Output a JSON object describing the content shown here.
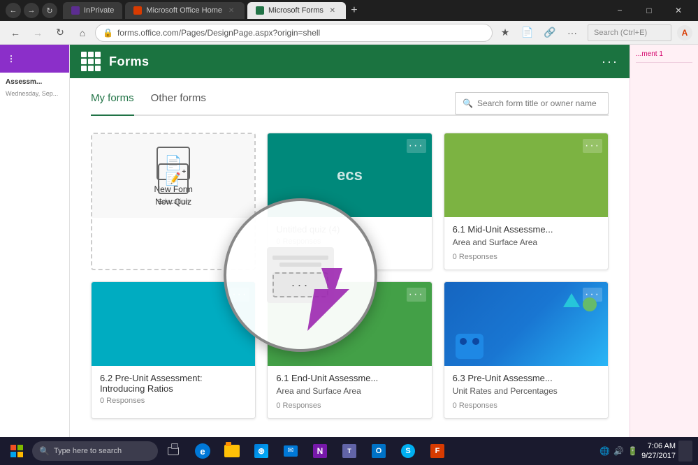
{
  "browser": {
    "title": "Microsoft Forms",
    "url": "forms.office.com/Pages/DesignPage.aspx?origin=shell",
    "tabs": [
      {
        "label": "InPrivate",
        "active": false
      },
      {
        "label": "Microsoft Office Home",
        "active": false
      },
      {
        "label": "Microsoft Forms",
        "active": true
      }
    ],
    "window_controls": [
      "minimize",
      "maximize",
      "close"
    ]
  },
  "header": {
    "app_name": "Forms",
    "dots_label": "···"
  },
  "navigation": {
    "my_forms": "My forms",
    "other_forms": "Other forms",
    "search_placeholder": "Search form title or owner name"
  },
  "new_form_card": {
    "label": "New Form",
    "sublabel": "Education",
    "quiz_label": "New Quiz"
  },
  "cards": [
    {
      "title": "Untitled quiz (4)",
      "subtitle": "",
      "responses": "0 Responses",
      "color": "teal"
    },
    {
      "title": "6.1 Mid-Unit Assessme...",
      "subtitle": "Area and Surface Area",
      "responses": "0 Responses",
      "color": "green"
    },
    {
      "title": "6.2 Pre-Unit Assessment: Introducing Ratios",
      "subtitle": "",
      "responses": "0 Responses",
      "color": "teal2"
    },
    {
      "title": "6.1 End-Unit Assessme...",
      "subtitle": "Area and Surface Area",
      "responses": "0 Responses",
      "color": "green2"
    },
    {
      "title": "6.3 Pre-Unit Assessme...",
      "subtitle": "Unit Rates and Percentages",
      "responses": "0 Responses",
      "color": "blue"
    }
  ],
  "magnifier": {
    "dots_label": "···"
  },
  "sidebar": {
    "top_color": "#8b2fc9",
    "items": []
  },
  "left_panel": {
    "title": "Assessm...",
    "subtitle": "Wednesday, Sep..."
  },
  "right_panel": {
    "label": "...ment 1",
    "items": []
  },
  "taskbar": {
    "search_placeholder": "Type here to search",
    "time": "7:06 AM",
    "date": "9/27/2017"
  }
}
